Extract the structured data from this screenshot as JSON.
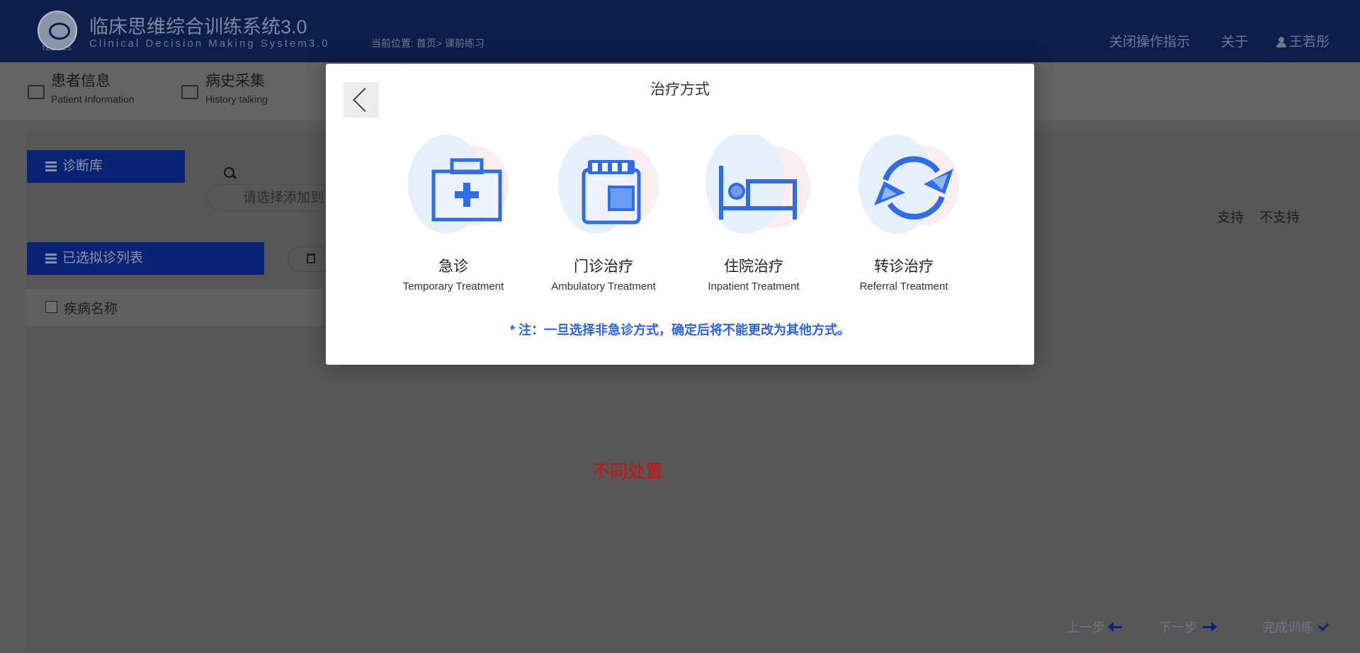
{
  "header": {
    "logo_text": "TELLYES",
    "title": "临床思维综合训练系统3.0",
    "subtitle": "Clinical Decision Making System3.0",
    "breadcrumb": "当前位置: 首页> 课前练习",
    "close_guide": "关闭操作指示",
    "about": "关于",
    "user": "王若彤"
  },
  "nav": {
    "items": [
      {
        "zh": "患者信息",
        "en": "Patient Information"
      },
      {
        "zh": "病史采集",
        "en": "History talking"
      }
    ]
  },
  "main": {
    "diag_lib": "诊断库",
    "search_placeholder": "请选择添加到",
    "selected_list": "已选拟诊列表",
    "column_disease": "疾病名称",
    "support": "支持",
    "not_support": "不支持",
    "hint": "不同处置",
    "prev": "上一步",
    "next": "下一步",
    "finish": "完成训练"
  },
  "modal": {
    "title": "治疗方式",
    "options": [
      {
        "zh": "急诊",
        "en": "Temporary Treatment",
        "icon": "first-aid-kit-icon"
      },
      {
        "zh": "门诊治疗",
        "en": "Ambulatory Treatment",
        "icon": "medicine-bottle-icon"
      },
      {
        "zh": "住院治疗",
        "en": "Inpatient Treatment",
        "icon": "hospital-bed-icon"
      },
      {
        "zh": "转诊治疗",
        "en": "Referral Treatment",
        "icon": "referral-cycle-icon"
      }
    ],
    "note": "* 注：一旦选择非急诊方式，确定后将不能更改为其他方式。"
  },
  "colors": {
    "header_bg": "#0e1e4a",
    "panel_blue": "#0b2375",
    "icon_blue": "#2f6de8",
    "note_blue": "#2a63e0",
    "hint_red": "#d10f12"
  }
}
